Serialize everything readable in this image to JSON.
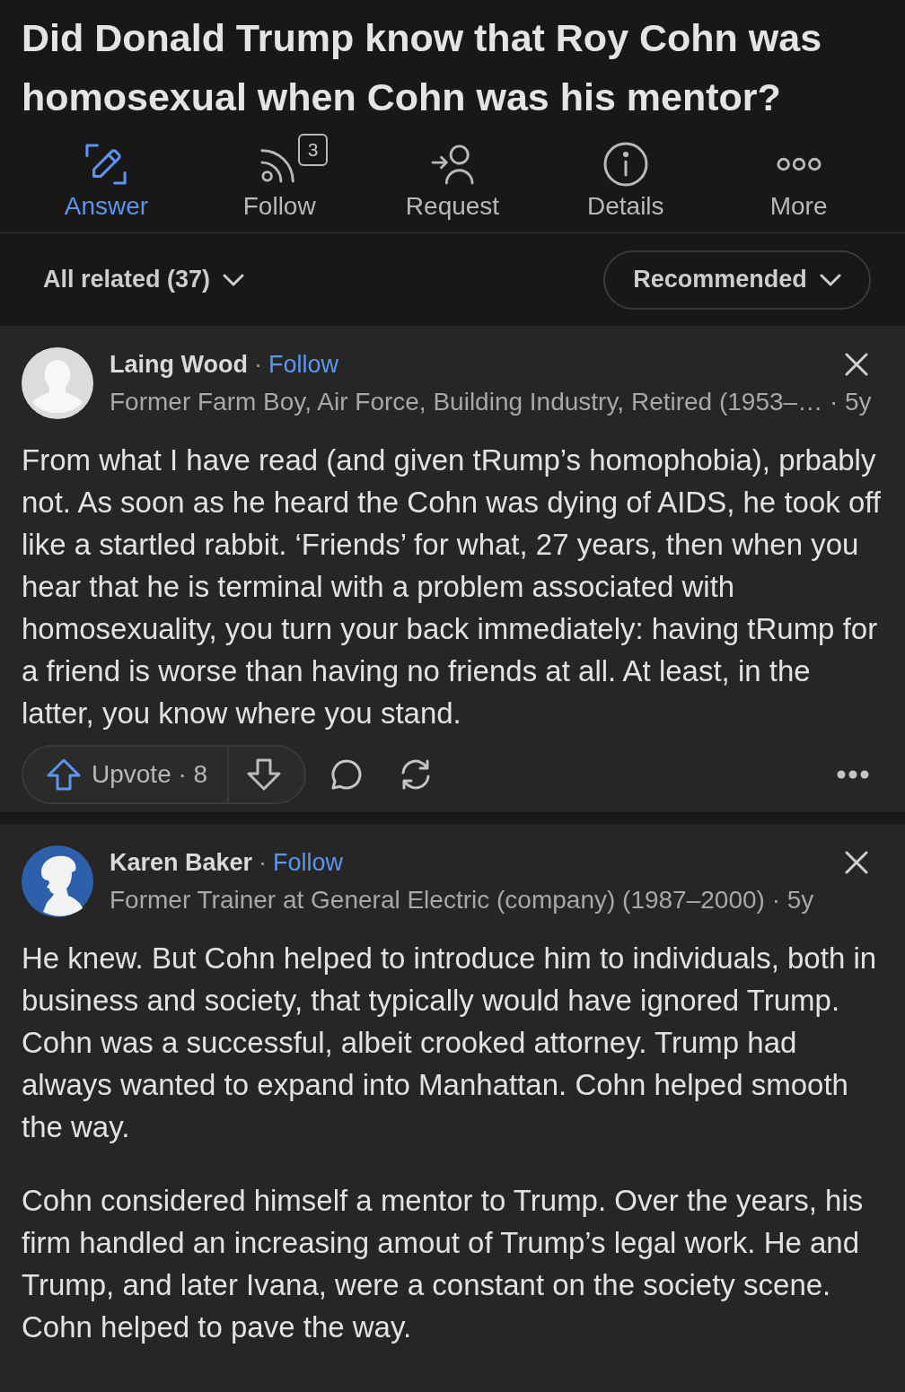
{
  "question": {
    "title": "Did Donald Trump know that Roy Cohn was homosexual when Cohn was his mentor?"
  },
  "actions": [
    {
      "kind": "answer",
      "label": "Answer",
      "highlighted": true
    },
    {
      "kind": "follow",
      "label": "Follow",
      "badge": "3",
      "highlighted": false
    },
    {
      "kind": "request",
      "label": "Request",
      "highlighted": false
    },
    {
      "kind": "details",
      "label": "Details",
      "highlighted": false
    },
    {
      "kind": "more",
      "label": "More",
      "highlighted": false
    }
  ],
  "filter_bar": {
    "related": "All related (37)",
    "sort": "Recommended"
  },
  "answers": [
    {
      "avatar": {
        "kind": "default"
      },
      "author": "Laing Wood",
      "separator": "·",
      "follow": "Follow",
      "credential": "Former Farm Boy, Air Force, Building Industry, Retired (1953–… · 5y",
      "paragraphs": [
        "From what I have read (and given tRump’s homophobia), prbably not. As soon as he heard the Cohn was dying of AIDS, he took off like a startled rabbit. ‘Friends’ for what, 27 years, then when you hear that he is terminal with a problem associated with homosexuality, you turn your back immediately: having tRump for a friend is worse than having no friends at all. At least, in the latter, you know where you stand."
      ],
      "upvote": "Upvote · 8"
    },
    {
      "avatar": {
        "kind": "silhouette"
      },
      "author": "Karen Baker",
      "separator": "·",
      "follow": "Follow",
      "credential": "Former Trainer at General Electric (company) (1987–2000) · 5y",
      "paragraphs": [
        "He knew. But Cohn helped to introduce him to individuals, both in business and society, that typically would have ignored Trump. Cohn was a successful, albeit crooked attorney. Trump had always wanted to expand into Manhattan. Cohn helped smooth the way.",
        "Cohn considered himself a mentor to Trump. Over the years, his firm handled an increasing amout of Trump’s legal work. He and Trump, and later Ivana, were a constant on the society scene. Cohn helped to pave the way."
      ]
    }
  ]
}
